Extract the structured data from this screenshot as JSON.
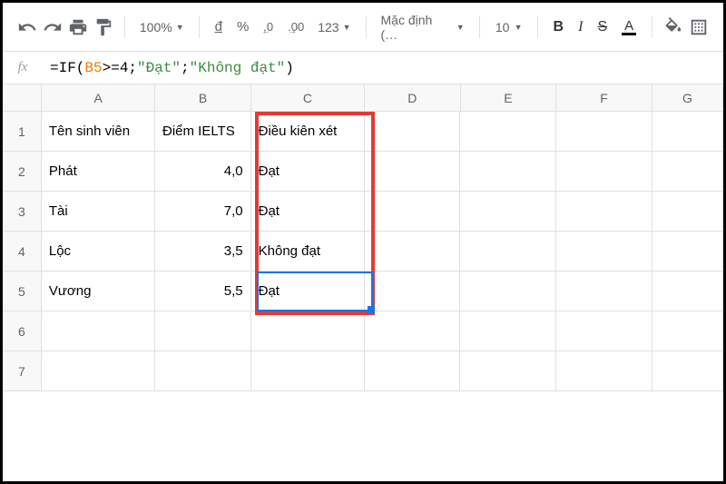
{
  "toolbar": {
    "zoom": "100%",
    "currency": "đ",
    "percent": "%",
    "dec_less": ".0",
    "dec_more": ".00",
    "numfmt": "123",
    "font": "Mặc định (…",
    "fontsize": "10",
    "bold": "B",
    "italic": "I",
    "strike": "S",
    "textcolor": "A"
  },
  "formula": {
    "prefix": "=IF(",
    "ref": "B5",
    "mid": ">=4;",
    "str1": "\"Đạt\"",
    "sep": ";",
    "str2": "\"Không đạt\"",
    "suffix": ")"
  },
  "cols": [
    "A",
    "B",
    "C",
    "D",
    "E",
    "F",
    "G"
  ],
  "rows": [
    "1",
    "2",
    "3",
    "4",
    "5",
    "6",
    "7"
  ],
  "headers": {
    "A": "Tên sinh viên",
    "B": "Điểm IELTS",
    "C": "Điều kiên xét"
  },
  "data": [
    {
      "name": "Phát",
      "score": "4,0",
      "result": "Đạt"
    },
    {
      "name": "Tài",
      "score": "7,0",
      "result": "Đạt"
    },
    {
      "name": "Lộc",
      "score": "3,5",
      "result": "Không đạt"
    },
    {
      "name": "Vương",
      "score": "5,5",
      "result": "Đạt"
    }
  ]
}
